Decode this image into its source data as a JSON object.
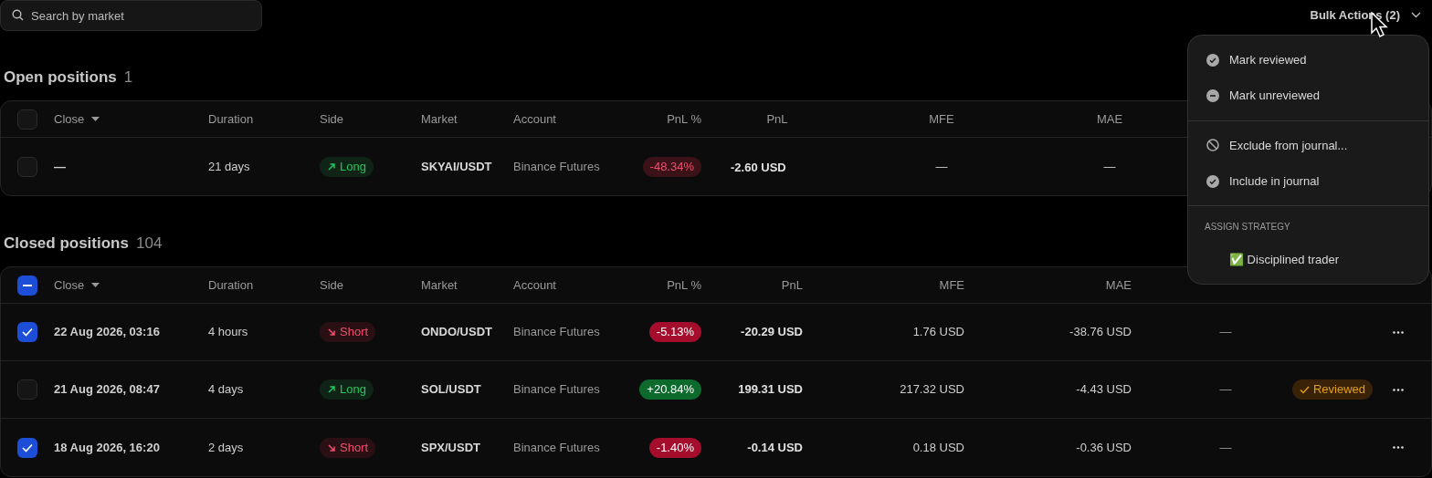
{
  "search": {
    "placeholder": "Search by market"
  },
  "bulk_actions": {
    "label": "Bulk Actions (2)",
    "expanded": true
  },
  "menu": {
    "items": [
      {
        "kind": "check",
        "label": "Mark reviewed"
      },
      {
        "kind": "minus",
        "label": "Mark unreviewed"
      },
      {
        "kind": "divider"
      },
      {
        "kind": "ban",
        "label": "Exclude from journal..."
      },
      {
        "kind": "check",
        "label": "Include in journal"
      },
      {
        "kind": "divider"
      },
      {
        "kind": "heading",
        "label": "ASSIGN STRATEGY"
      },
      {
        "kind": "strategy",
        "label": "✅ Disciplined trader"
      }
    ]
  },
  "open_positions": {
    "title": "Open positions",
    "count": "1",
    "header_checkbox": {
      "indeterminate": false
    },
    "columns": [
      {
        "label": "Close",
        "sorted": true
      },
      {
        "label": "Duration",
        "sorted": false
      },
      {
        "label": "Side",
        "sorted": false
      },
      {
        "label": "Market",
        "sorted": false
      },
      {
        "label": "Account",
        "sorted": false
      },
      {
        "label": "PnL %",
        "sorted": false
      },
      {
        "label": "PnL",
        "sorted": false
      },
      {
        "label": "MFE",
        "sorted": false
      },
      {
        "label": "MAE",
        "sorted": false
      }
    ],
    "rows": [
      {
        "checked": false,
        "close": "—",
        "duration": "21 days",
        "side": {
          "label": "Long",
          "kind": "long"
        },
        "market": "SKYAI/USDT",
        "account": "Binance Futures",
        "pnl_pct": {
          "text": "-48.34%",
          "kind": "loss_muted"
        },
        "pnl": "-2.60 USD",
        "mfe": "—",
        "mae": "—"
      }
    ]
  },
  "closed_positions": {
    "title": "Closed positions",
    "count": "104",
    "header_checkbox": {
      "indeterminate": true
    },
    "columns": [
      {
        "label": "Close",
        "sorted": true
      },
      {
        "label": "Duration",
        "sorted": false
      },
      {
        "label": "Side",
        "sorted": false
      },
      {
        "label": "Market",
        "sorted": false
      },
      {
        "label": "Account",
        "sorted": false
      },
      {
        "label": "PnL %",
        "sorted": false
      },
      {
        "label": "PnL",
        "sorted": false
      },
      {
        "label": "MFE",
        "sorted": false
      },
      {
        "label": "MAE",
        "sorted": false
      }
    ],
    "rows": [
      {
        "checked": true,
        "close": "22 Aug 2026, 03:16",
        "duration": "4 hours",
        "side": {
          "label": "Short",
          "kind": "short"
        },
        "market": "ONDO/USDT",
        "account": "Binance Futures",
        "pnl_pct": {
          "text": "-5.13%",
          "kind": "loss"
        },
        "pnl": "-20.29 USD",
        "mfe": "1.76 USD",
        "mae": "-38.76 USD",
        "rr": "—"
      },
      {
        "checked": false,
        "close": "21 Aug 2026, 08:47",
        "duration": "4 days",
        "side": {
          "label": "Long",
          "kind": "long"
        },
        "market": "SOL/USDT",
        "account": "Binance Futures",
        "pnl_pct": {
          "text": "+20.84%",
          "kind": "gain"
        },
        "pnl": "199.31 USD",
        "mfe": "217.32 USD",
        "mae": "-4.43 USD",
        "rr": "—",
        "status": "Reviewed"
      },
      {
        "checked": true,
        "close": "18 Aug 2026, 16:20",
        "duration": "2 days",
        "side": {
          "label": "Short",
          "kind": "short"
        },
        "market": "SPX/USDT",
        "account": "Binance Futures",
        "pnl_pct": {
          "text": "-1.40%",
          "kind": "loss"
        },
        "pnl": "-0.14 USD",
        "mfe": "0.18 USD",
        "mae": "-0.36 USD",
        "rr": "—"
      }
    ]
  }
}
